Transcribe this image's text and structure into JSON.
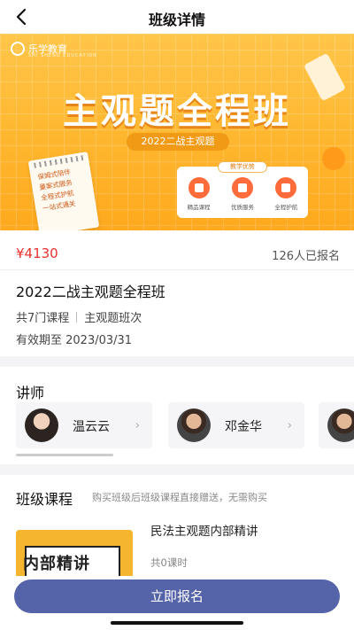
{
  "nav": {
    "title": "班级详情"
  },
  "banner": {
    "logo_text": "乐学教育",
    "logo_sub": "SHI SHENG EDUCATION",
    "title": "主观题全程班",
    "tag": "2022二战主观题",
    "paper_lines": [
      "保姆式陪伴",
      "量案式服务",
      "全程式护航",
      "一站式通关"
    ],
    "advantages_title": "教学优势",
    "advantages": [
      "精品课程",
      "优质服务",
      "全程护航"
    ]
  },
  "info": {
    "price": "¥4130",
    "enrolled": "126人已报名",
    "course_title": "2022二战主观题全程班",
    "course_count": "共7门课程",
    "course_type": "主观题班次",
    "expire": "有效期至 2023/03/31"
  },
  "teachers": {
    "title": "讲师",
    "items": [
      {
        "name": "温云云"
      },
      {
        "name": "邓金华"
      }
    ]
  },
  "lessons": {
    "title": "班级课程",
    "subtitle": "购买班级后班级课程直接赠送，无需购买",
    "thumb_text": "内部精讲",
    "items": [
      {
        "name": "民法主观题内部精讲",
        "count": "共0课时"
      }
    ]
  },
  "footer": {
    "enroll_label": "立即报名"
  },
  "colors": {
    "price": "#e8322e",
    "accent": "#5563a8",
    "banner": "#ffb62e"
  }
}
